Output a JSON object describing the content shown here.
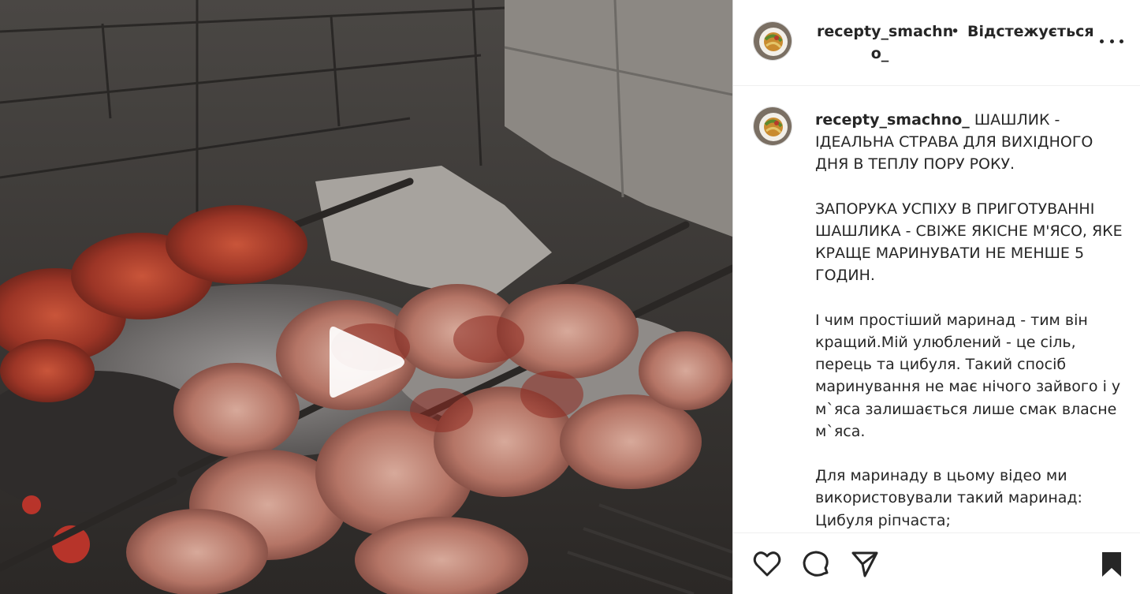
{
  "post": {
    "author": {
      "username_line1": "recepty_smachn",
      "username_line2": "o_",
      "separator": "•",
      "follow_label": "Відстежується",
      "avatar_icon": "salad-plate-avatar"
    },
    "caption": {
      "username": "recepty_smachno_",
      "text": " ШАШЛИК - ІДЕАЛЬНА СТРАВА ДЛЯ ВИХІДНОГО ДНЯ В ТЕПЛУ ПОРУ РОКУ.\n\nЗАПОРУКА УСПІХУ В ПРИГОТУВАННІ ШАШЛИКА - СВІЖЕ ЯКІСНЕ М'ЯСО, ЯКЕ КРАЩЕ МАРИНУВАТИ НЕ МЕНШЕ 5 ГОДИН.\n\nІ чим простіший маринад - тим він кращий.Мій улюблений - це сіль, перець та цибуля. Такий спосіб маринування не має нічого зайвого і у м`яса залишається лише смак власне м`яса.\n\nДля маринаду в цьому відео ми використовували такий маринад:\nЦибуля ріпчаста;"
    },
    "media": {
      "type": "video",
      "play_icon": "play-icon"
    },
    "actions": [
      "heart-icon",
      "comment-icon",
      "share-icon",
      "bookmark-icon"
    ],
    "colors": {
      "text": "#262626",
      "border": "#dbdbdb"
    }
  }
}
